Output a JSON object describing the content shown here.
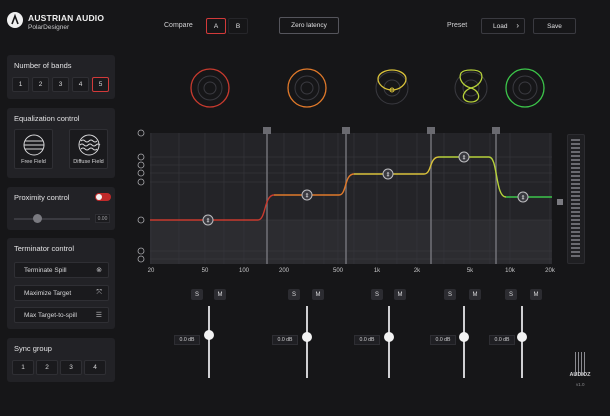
{
  "app": {
    "brand": "AUSTRIAN AUDIO",
    "product": "PolarDesigner"
  },
  "header": {
    "compare_label": "Compare",
    "compare_a": "A",
    "compare_b": "B",
    "zero_latency": "Zero latency",
    "preset_label": "Preset",
    "load": "Load",
    "save": "Save"
  },
  "sidebar": {
    "bands": {
      "title": "Number of bands",
      "options": [
        "1",
        "2",
        "3",
        "4",
        "5"
      ],
      "selected": "5"
    },
    "eq": {
      "title": "Equalization control",
      "free_field": "Free Field",
      "diffuse_field": "Diffuse Field"
    },
    "proximity": {
      "title": "Proximity control",
      "value": "0.00",
      "toggle_on": true
    },
    "terminator": {
      "title": "Terminator control",
      "items": [
        "Terminate Spill",
        "Maximize Target",
        "Max Target-to-spill"
      ]
    },
    "sync": {
      "title": "Sync group",
      "options": [
        "1",
        "2",
        "3",
        "4"
      ]
    }
  },
  "eq_graph": {
    "x_ticks": [
      "20",
      "50",
      "100",
      "200",
      "500",
      "1k",
      "2k",
      "5k",
      "10k",
      "20k"
    ],
    "band_colors": [
      "#c83a2e",
      "#e0792a",
      "#d9c23a",
      "#b7d23a",
      "#3cc54a"
    ]
  },
  "bands": [
    {
      "s": "S",
      "m": "M",
      "gain": "0.0 dB"
    },
    {
      "s": "S",
      "m": "M",
      "gain": "0.0 dB"
    },
    {
      "s": "S",
      "m": "M",
      "gain": "0.0 dB"
    },
    {
      "s": "S",
      "m": "M",
      "gain": "0.0 dB"
    },
    {
      "s": "S",
      "m": "M",
      "gain": "0.0 dB"
    }
  ],
  "footer": {
    "logo": "AUDIOZ",
    "version": "v1.0"
  }
}
